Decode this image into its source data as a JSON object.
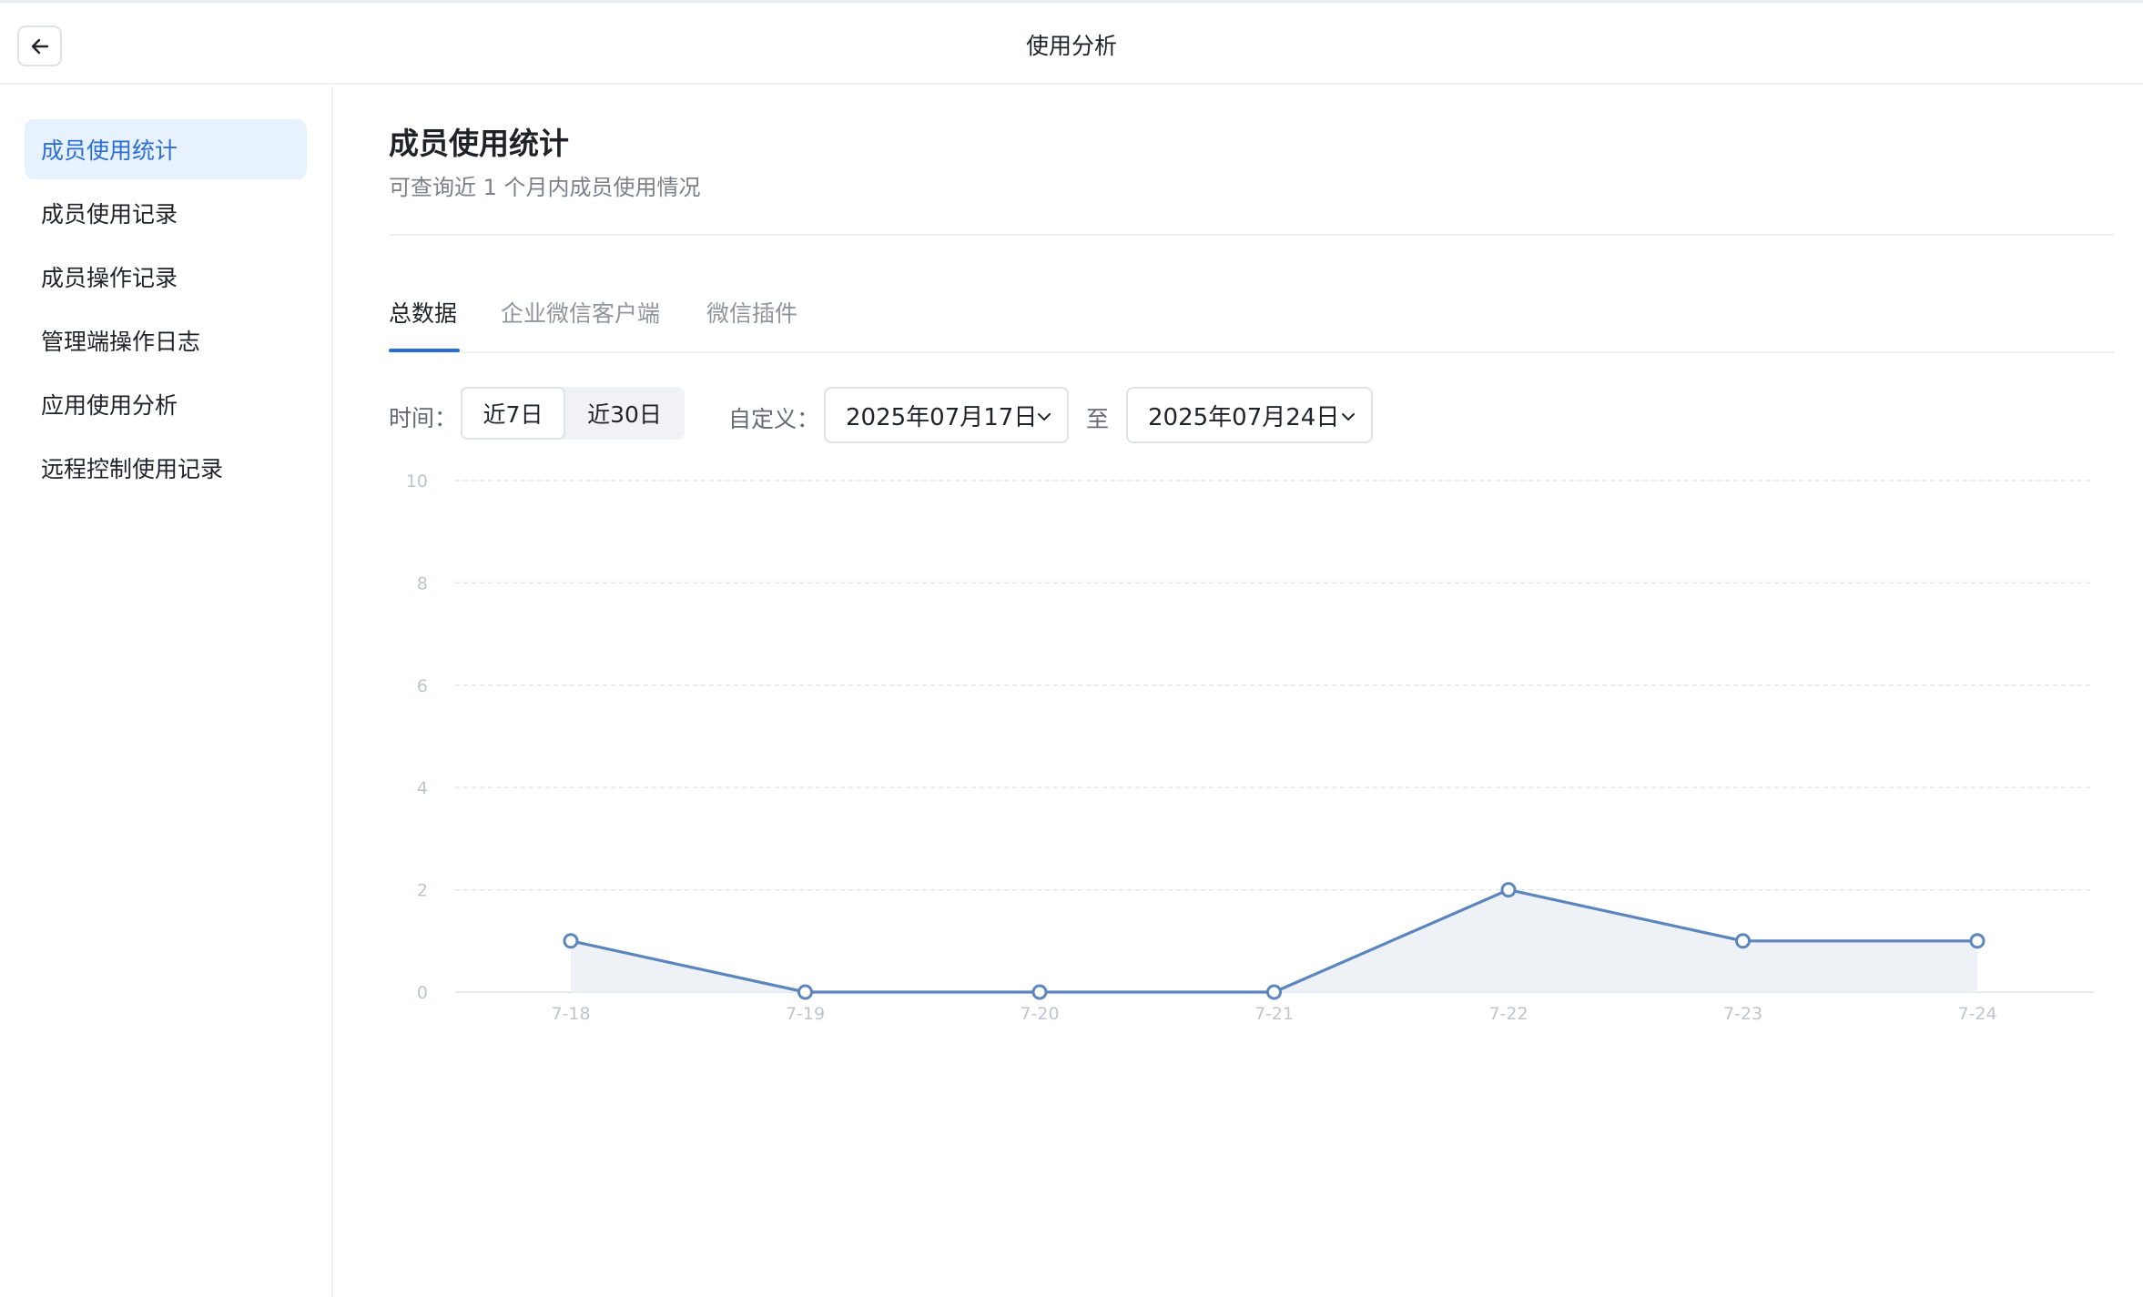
{
  "window": {
    "title": "使用分析"
  },
  "sidebar": {
    "items": [
      {
        "label": "成员使用统计",
        "active": true
      },
      {
        "label": "成员使用记录",
        "active": false
      },
      {
        "label": "成员操作记录",
        "active": false
      },
      {
        "label": "管理端操作日志",
        "active": false
      },
      {
        "label": "应用使用分析",
        "active": false
      },
      {
        "label": "远程控制使用记录",
        "active": false
      }
    ]
  },
  "main": {
    "title": "成员使用统计",
    "subtitle": "可查询近 1 个月内成员使用情况",
    "tabs": [
      {
        "label": "总数据",
        "active": true
      },
      {
        "label": "企业微信客户端",
        "active": false
      },
      {
        "label": "微信插件",
        "active": false
      }
    ],
    "filters": {
      "time_label": "时间：",
      "ranges": [
        {
          "label": "近7日",
          "active": true
        },
        {
          "label": "近30日",
          "active": false
        }
      ],
      "custom_label": "自定义：",
      "start_date": "2025年07月17日",
      "separator": "至",
      "end_date": "2025年07月24日"
    }
  },
  "colors": {
    "accent": "#2b6fd6",
    "line": "#5b86bd",
    "area": "#eef2f7",
    "grid": "#e3e6eb"
  },
  "chart_data": {
    "type": "area",
    "categories": [
      "7-18",
      "7-19",
      "7-20",
      "7-21",
      "7-22",
      "7-23",
      "7-24"
    ],
    "values": [
      1,
      0,
      0,
      0,
      2,
      1,
      1
    ],
    "ylim": [
      0,
      10
    ],
    "yticks": [
      0,
      2,
      4,
      6,
      8,
      10
    ],
    "grid": true
  }
}
